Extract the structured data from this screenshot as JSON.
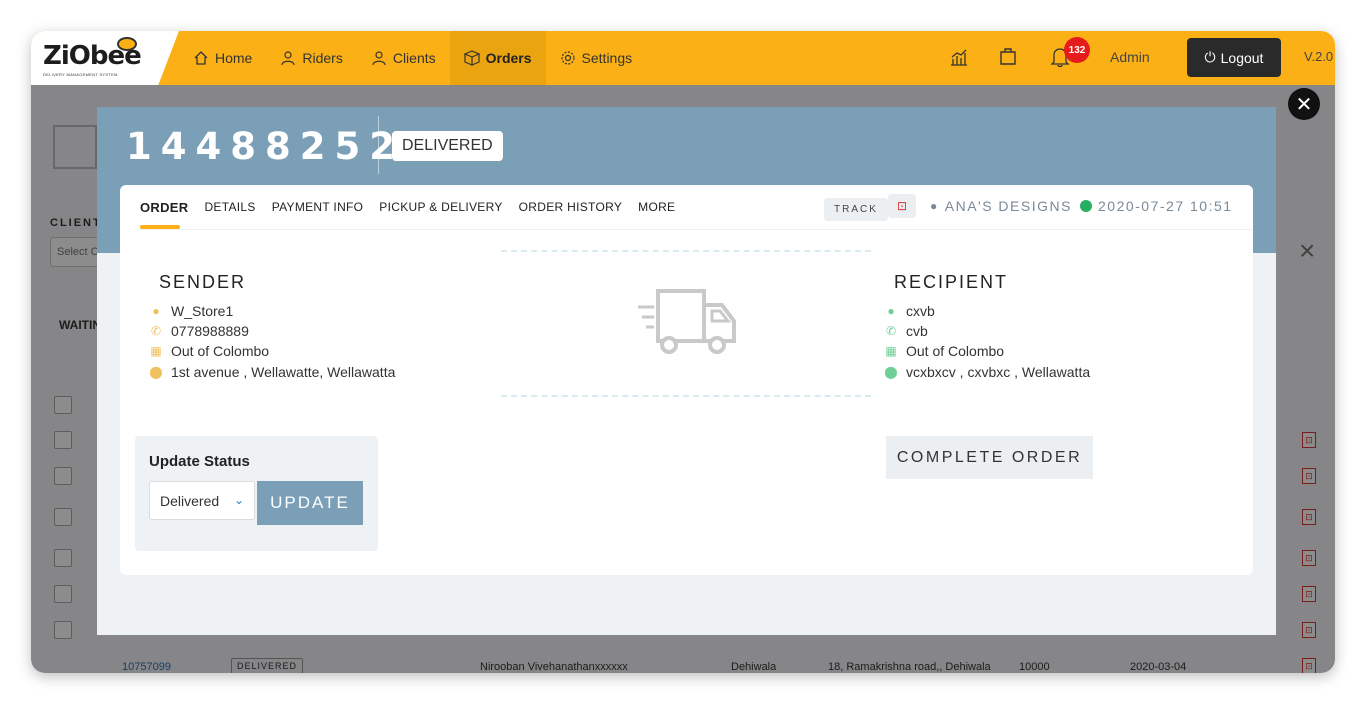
{
  "brand": {
    "logo_text": "ZiObee",
    "logo_tagline": "DELIVERY MANAGEMENT SYSTEM"
  },
  "nav": {
    "items": [
      {
        "label": "Home",
        "icon": "home-icon"
      },
      {
        "label": "Riders",
        "icon": "user-icon"
      },
      {
        "label": "Clients",
        "icon": "user-icon"
      },
      {
        "label": "Orders",
        "icon": "box-icon",
        "active": true
      },
      {
        "label": "Settings",
        "icon": "gear-icon"
      }
    ],
    "notification_count": "132",
    "user": "Admin",
    "logout_label": "Logout",
    "version": "V.2.0"
  },
  "background": {
    "client_label": "CLIENT",
    "client_placeholder": "Select C",
    "waiting_label": "WAITIN",
    "last_row": {
      "order_id": "10757099",
      "status": "DELIVERED",
      "name": "Nirooban Vivehanathanxxxxxx",
      "city": "Dehiwala",
      "address": "18, Ramakrishna road,, Dehiwala",
      "zip": "10000",
      "date": "2020-03-04"
    }
  },
  "modal": {
    "order_number": "14488252",
    "status": "DELIVERED",
    "tabs": [
      "ORDER",
      "DETAILS",
      "PAYMENT INFO",
      "PICKUP & DELIVERY",
      "ORDER HISTORY",
      "MORE"
    ],
    "track_label": "TRACK",
    "client": "ANA'S DESIGNS",
    "datetime": "2020-07-27 10:51",
    "sender": {
      "title": "SENDER",
      "name": "W_Store1",
      "phone": "0778988889",
      "area": "Out of Colombo",
      "address": "1st avenue , Wellawatte, Wellawatta"
    },
    "recipient": {
      "title": "RECIPIENT",
      "name": "cxvb",
      "phone": "cvb",
      "area": "Out of Colombo",
      "address": "vcxbxcv , cxvbxc , Wellawatta"
    },
    "update": {
      "title": "Update Status",
      "selected": "Delivered",
      "button": "UPDATE"
    },
    "complete_button": "COMPLETE ORDER"
  },
  "colors": {
    "brand_yellow": "#fbb116",
    "modal_head": "#7b9fb7",
    "sender_icon": "#f0c060",
    "recipient_icon": "#6fcf97"
  }
}
